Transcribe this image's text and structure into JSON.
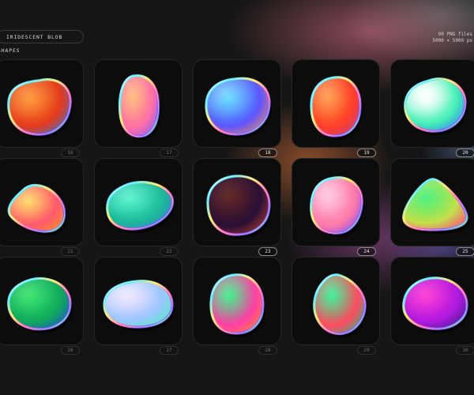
{
  "header": {
    "title": "IRIDESCENT BLOB SHAPES",
    "meta_line1": "90 PNG files",
    "meta_line2": "5000 × 5000 px"
  },
  "tiles": [
    {
      "label": "16",
      "colors": [
        "#ff8a1a",
        "#e33a1f",
        "#2f7bd9"
      ],
      "hl": "rgba(255,255,255,0.2)"
    },
    {
      "label": "17",
      "colors": [
        "#ffb36a",
        "#ff6fa8",
        "#7a5cff"
      ],
      "hl": "rgba(255,255,255,0.2)"
    },
    {
      "label": "18",
      "colors": [
        "#37d1ff",
        "#5f55ff",
        "#ff8f4f"
      ],
      "hl": "rgba(255,255,255,0.35)"
    },
    {
      "label": "19",
      "colors": [
        "#ff8a2a",
        "#ff3f2a",
        "#c43b8a"
      ],
      "hl": "rgba(255,255,255,0.25)"
    },
    {
      "label": "20",
      "colors": [
        "#ffffff",
        "#45f0b5",
        "#3b6bff"
      ],
      "hl": "rgba(255,255,255,0.8)"
    },
    {
      "label": "21",
      "colors": [
        "#ffd24a",
        "#ff5a6e",
        "#ff8d2a"
      ],
      "hl": "rgba(255,255,255,0.25)"
    },
    {
      "label": "22",
      "colors": [
        "#35f0c4",
        "#1fb89a",
        "#2b7bd6"
      ],
      "hl": "rgba(255,255,255,0.25)"
    },
    {
      "label": "23",
      "colors": [
        "#5a1a1a",
        "#2a1036",
        "#c33d2a"
      ],
      "hl": "rgba(255,255,255,0.08)"
    },
    {
      "label": "24",
      "colors": [
        "#ffb5d6",
        "#ff7aa8",
        "#7b4bff"
      ],
      "hl": "rgba(255,255,255,0.35)"
    },
    {
      "label": "25",
      "colors": [
        "#2ff06a",
        "#c3e04c",
        "#ff4b7a"
      ],
      "hl": "rgba(255,255,255,0.2)"
    },
    {
      "label": "26",
      "colors": [
        "#1de05a",
        "#12a85e",
        "#1a4ad9"
      ],
      "hl": "rgba(255,255,255,0.2)"
    },
    {
      "label": "27",
      "colors": [
        "#e9d8ff",
        "#9ac7ff",
        "#46f0b0"
      ],
      "hl": "rgba(255,255,255,0.45)"
    },
    {
      "label": "28",
      "colors": [
        "#23f07a",
        "#ff3fa6",
        "#ff8a2a"
      ],
      "hl": "rgba(255,255,255,0.2)"
    },
    {
      "label": "29",
      "colors": [
        "#1ff08a",
        "#ff4b5f",
        "#1dbf85"
      ],
      "hl": "rgba(255,255,255,0.2)"
    },
    {
      "label": "30",
      "colors": [
        "#ff2ad0",
        "#b01ae0",
        "#3f1a8a"
      ],
      "hl": "rgba(255,255,255,0.15)"
    }
  ]
}
